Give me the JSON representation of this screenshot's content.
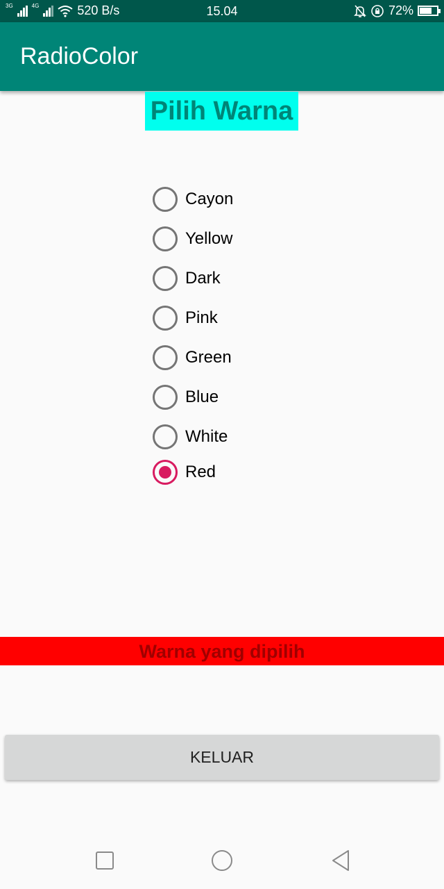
{
  "status_bar": {
    "network_3g": "3G",
    "network_4g": "4G",
    "speed": "520 B/s",
    "time": "15.04",
    "battery_percent": "72%",
    "battery_level": 0.72,
    "icons": [
      "signal-icon",
      "wifi-icon",
      "bell-off-icon",
      "rotation-lock-icon",
      "battery-icon"
    ]
  },
  "app_bar": {
    "title": "RadioColor"
  },
  "heading": {
    "text": "Pilih Warna",
    "background": "#00ffee",
    "color": "#008577"
  },
  "radio_options": [
    {
      "label": "Cayon",
      "checked": false
    },
    {
      "label": "Yellow",
      "checked": false
    },
    {
      "label": "Dark",
      "checked": false
    },
    {
      "label": "Pink",
      "checked": false
    },
    {
      "label": "Green",
      "checked": false
    },
    {
      "label": "Blue",
      "checked": false
    },
    {
      "label": "White",
      "checked": false
    },
    {
      "label": "Red",
      "checked": true
    }
  ],
  "result": {
    "text": "Warna yang dipilih",
    "background": "#ff0000",
    "color": "#a00000"
  },
  "button": {
    "label": "KELUAR"
  },
  "colors": {
    "primary": "#008577",
    "primary_dark": "#00574b",
    "accent": "#d81b60"
  },
  "nav_bar": {
    "icons": [
      "recents-square-icon",
      "home-circle-icon",
      "back-triangle-icon"
    ]
  }
}
